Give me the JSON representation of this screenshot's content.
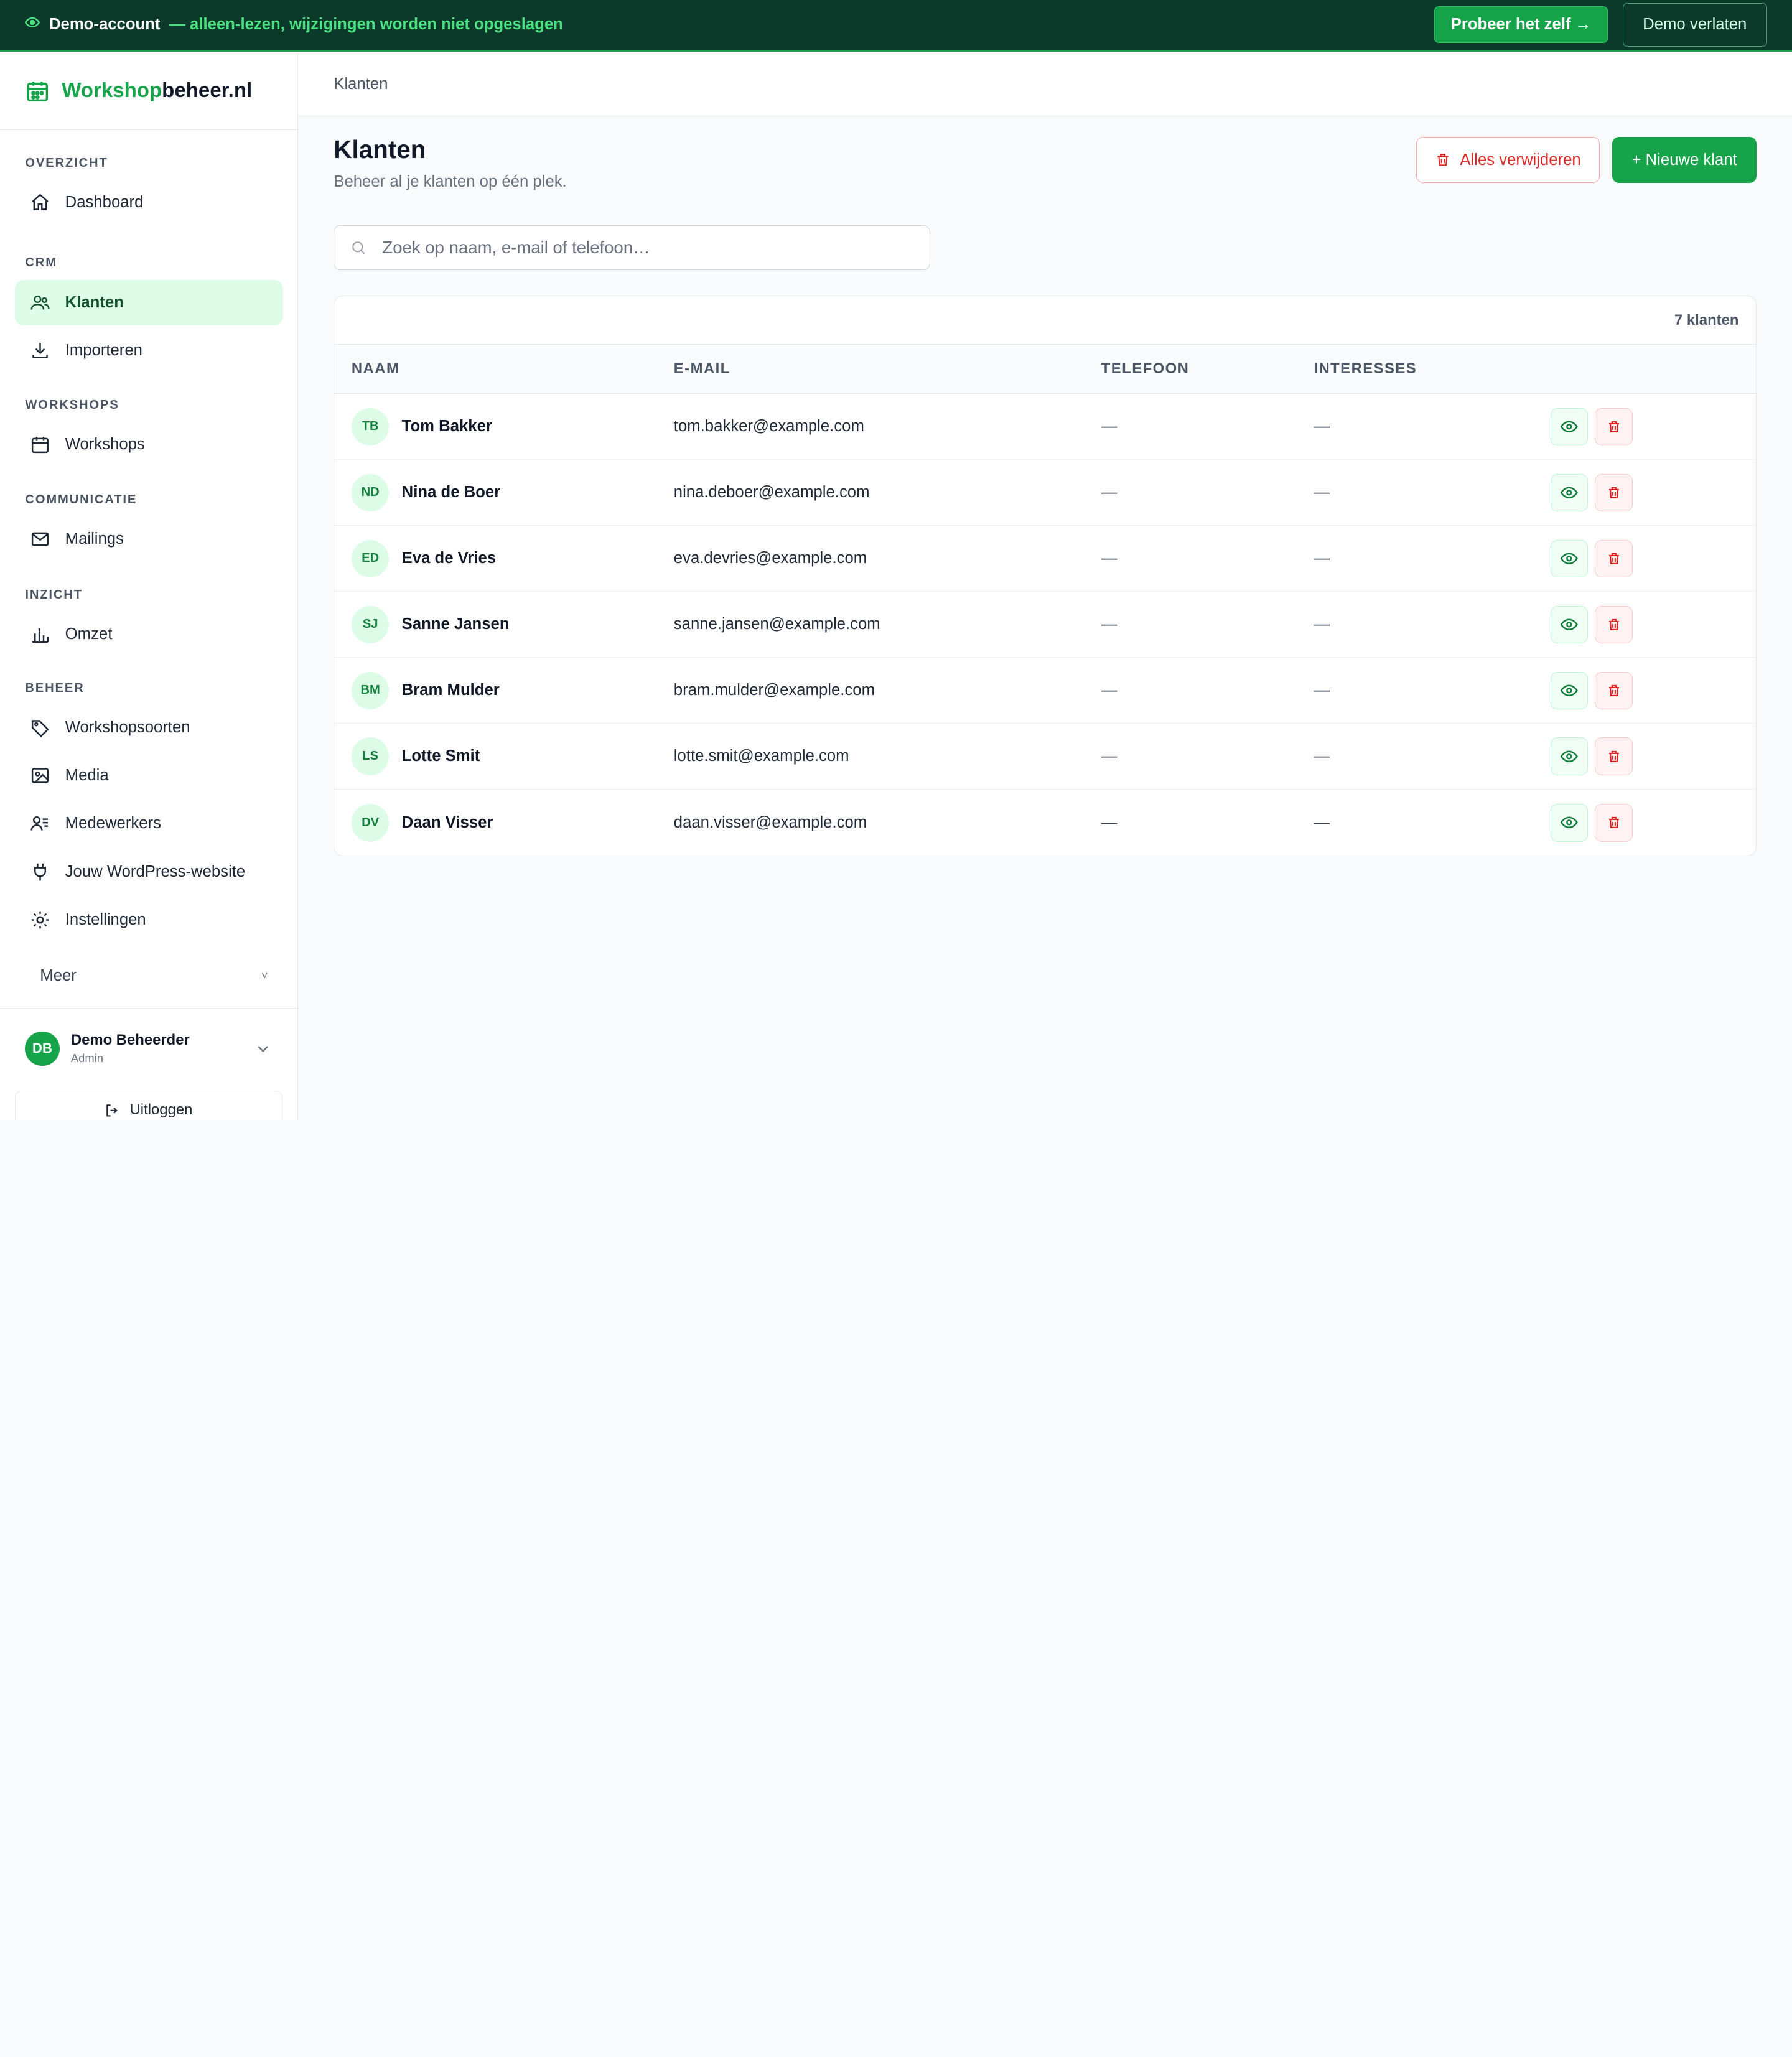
{
  "banner": {
    "account": "Demo-account",
    "note": "— alleen-lezen, wijzigingen worden niet opgeslagen",
    "try_button": "Probeer het zelf →",
    "leave_button": "Demo verlaten"
  },
  "brand": {
    "part1": "Workshop",
    "part2": "beheer.nl"
  },
  "sidebar": {
    "sections": [
      {
        "title": "OVERZICHT",
        "items": [
          {
            "label": "Dashboard",
            "icon": "home-icon"
          }
        ]
      },
      {
        "title": "CRM",
        "items": [
          {
            "label": "Klanten",
            "icon": "users-icon",
            "active": true
          },
          {
            "label": "Importeren",
            "icon": "download-icon"
          }
        ]
      },
      {
        "title": "WORKSHOPS",
        "items": [
          {
            "label": "Workshops",
            "icon": "calendar-icon"
          }
        ]
      },
      {
        "title": "COMMUNICATIE",
        "items": [
          {
            "label": "Mailings",
            "icon": "mail-icon"
          }
        ]
      },
      {
        "title": "INZICHT",
        "items": [
          {
            "label": "Omzet",
            "icon": "bar-chart-icon"
          }
        ]
      },
      {
        "title": "BEHEER",
        "items": [
          {
            "label": "Workshopsoorten",
            "icon": "tag-icon"
          },
          {
            "label": "Media",
            "icon": "image-icon"
          },
          {
            "label": "Medewerkers",
            "icon": "staff-icon"
          },
          {
            "label": "Jouw WordPress-website",
            "icon": "plug-icon"
          },
          {
            "label": "Instellingen",
            "icon": "settings-icon"
          }
        ]
      }
    ],
    "more": "Meer",
    "user": {
      "initials": "DB",
      "name": "Demo Beheerder",
      "role": "Admin"
    },
    "logout": "Uitloggen"
  },
  "topbar": {
    "breadcrumb": "Klanten"
  },
  "page": {
    "title": "Klanten",
    "subtitle": "Beheer al je klanten op één plek.",
    "delete_all": "Alles verwijderen",
    "new_customer": "+ Nieuwe klant",
    "search_placeholder": "Zoek op naam, e-mail of telefoon…",
    "count": "7 klanten"
  },
  "table": {
    "headers": {
      "name": "NAAM",
      "email": "E-MAIL",
      "phone": "TELEFOON",
      "interests": "INTERESSES"
    },
    "rows": [
      {
        "initials": "TB",
        "name": "Tom Bakker",
        "email": "tom.bakker@example.com",
        "phone": "—",
        "interests": "—"
      },
      {
        "initials": "ND",
        "name": "Nina de Boer",
        "email": "nina.deboer@example.com",
        "phone": "—",
        "interests": "—"
      },
      {
        "initials": "ED",
        "name": "Eva de Vries",
        "email": "eva.devries@example.com",
        "phone": "—",
        "interests": "—"
      },
      {
        "initials": "SJ",
        "name": "Sanne Jansen",
        "email": "sanne.jansen@example.com",
        "phone": "—",
        "interests": "—"
      },
      {
        "initials": "BM",
        "name": "Bram Mulder",
        "email": "bram.mulder@example.com",
        "phone": "—",
        "interests": "—"
      },
      {
        "initials": "LS",
        "name": "Lotte Smit",
        "email": "lotte.smit@example.com",
        "phone": "—",
        "interests": "—"
      },
      {
        "initials": "DV",
        "name": "Daan Visser",
        "email": "daan.visser@example.com",
        "phone": "—",
        "interests": "—"
      }
    ]
  },
  "colors": {
    "brand_green": "#16a34a",
    "banner_bg": "#0b3a2a",
    "danger": "#dc2626",
    "active_bg": "#dcfce7"
  }
}
